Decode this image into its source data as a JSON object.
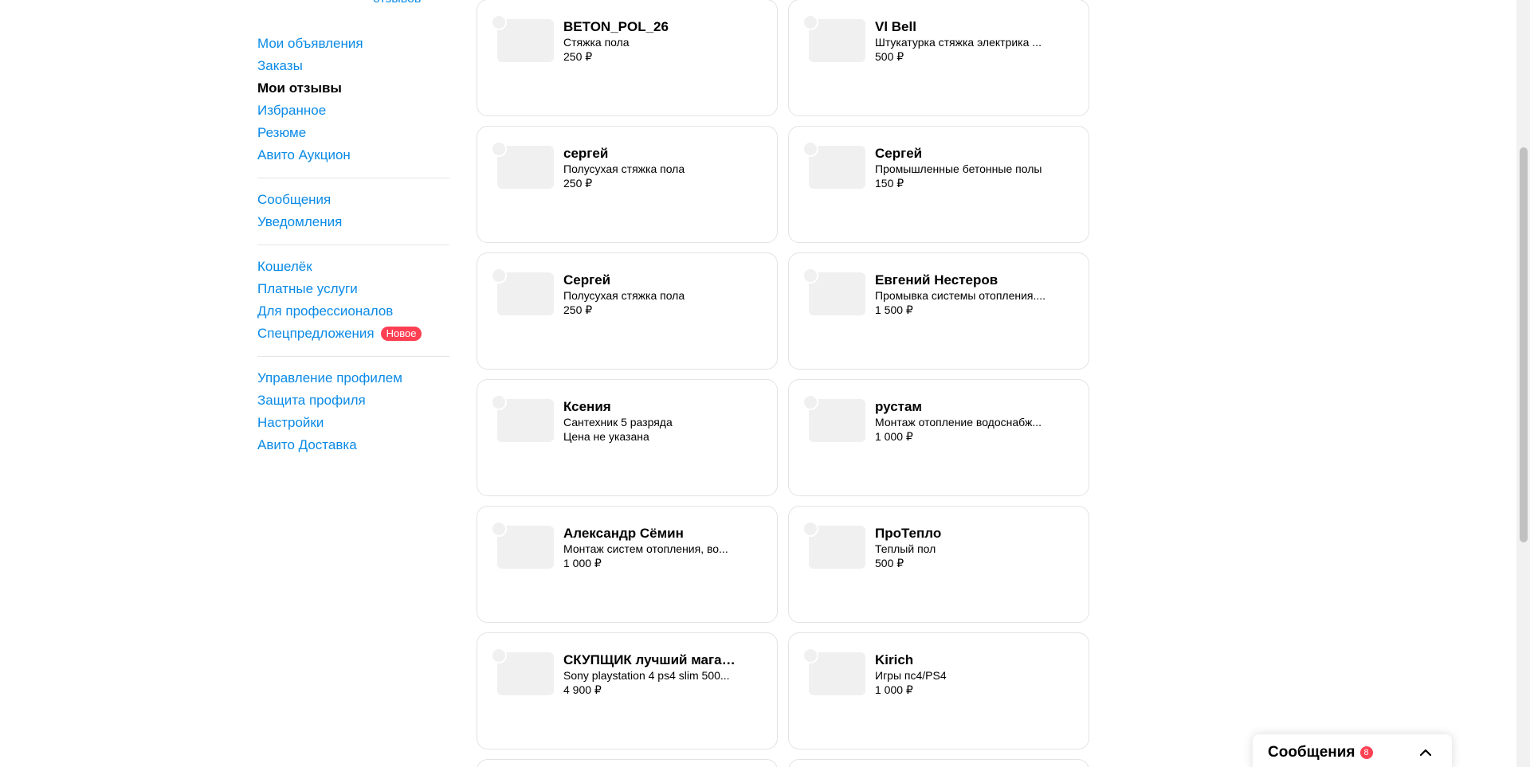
{
  "sidebar": {
    "top_reviews_link": "отзывов",
    "groups": [
      {
        "items": [
          {
            "label": "Мои объявления",
            "name": "sidebar-item-my-ads",
            "active": false
          },
          {
            "label": "Заказы",
            "name": "sidebar-item-orders",
            "active": false
          },
          {
            "label": "Мои отзывы",
            "name": "sidebar-item-my-reviews",
            "active": true
          },
          {
            "label": "Избранное",
            "name": "sidebar-item-favorites",
            "active": false
          },
          {
            "label": "Резюме",
            "name": "sidebar-item-resume",
            "active": false
          },
          {
            "label": "Авито Аукцион",
            "name": "sidebar-item-avito-auction",
            "active": false
          }
        ]
      },
      {
        "items": [
          {
            "label": "Сообщения",
            "name": "sidebar-item-messages",
            "active": false
          },
          {
            "label": "Уведомления",
            "name": "sidebar-item-notifications",
            "active": false
          }
        ]
      },
      {
        "items": [
          {
            "label": "Кошелёк",
            "name": "sidebar-item-wallet",
            "active": false
          },
          {
            "label": "Платные услуги",
            "name": "sidebar-item-paid-services",
            "active": false
          },
          {
            "label": "Для профессионалов",
            "name": "sidebar-item-for-professionals",
            "active": false
          },
          {
            "label": "Спецпредложения",
            "name": "sidebar-item-special-offers",
            "active": false,
            "badge": "Новое"
          }
        ]
      },
      {
        "items": [
          {
            "label": "Управление профилем",
            "name": "sidebar-item-profile-management",
            "active": false
          },
          {
            "label": "Защита профиля",
            "name": "sidebar-item-profile-protection",
            "active": false
          },
          {
            "label": "Настройки",
            "name": "sidebar-item-settings",
            "active": false
          },
          {
            "label": "Авито Доставка",
            "name": "sidebar-item-avito-delivery",
            "active": false
          }
        ]
      }
    ]
  },
  "cards": [
    {
      "name": "BETON_POL_26",
      "desc": "Стяжка пола",
      "price": "250 ₽"
    },
    {
      "name": "Vl Bell",
      "desc": "Штукатурка стяжка электрика ...",
      "price": "500 ₽"
    },
    {
      "name": "сергей",
      "desc": "Полусухая стяжка пола",
      "price": "250 ₽"
    },
    {
      "name": "Сергей",
      "desc": "Промышленные бетонные полы",
      "price": "150 ₽"
    },
    {
      "name": "Сергей",
      "desc": "Полусухая стяжка пола",
      "price": "250 ₽"
    },
    {
      "name": "Евгений Нестеров",
      "desc": "Промывка системы отопления....",
      "price": "1 500 ₽"
    },
    {
      "name": "Ксения",
      "desc": "Сантехник 5 разряда",
      "price": "Цена не указана"
    },
    {
      "name": "рустам",
      "desc": "Монтаж отопление водоснабж...",
      "price": "1 000 ₽"
    },
    {
      "name": "Александр Сёмин",
      "desc": "Монтаж систем отопления, во...",
      "price": "1 000 ₽"
    },
    {
      "name": "ПроТепло",
      "desc": "Теплый пол",
      "price": "500 ₽"
    },
    {
      "name": "СКУПЩИК лучший магази...",
      "desc": "Sony playstation 4 ps4 slim 500...",
      "price": "4 900 ₽"
    },
    {
      "name": "Kirich",
      "desc": "Игры пс4/PS4",
      "price": "1 000 ₽"
    }
  ],
  "messages_widget": {
    "title": "Сообщения",
    "count": "8"
  }
}
